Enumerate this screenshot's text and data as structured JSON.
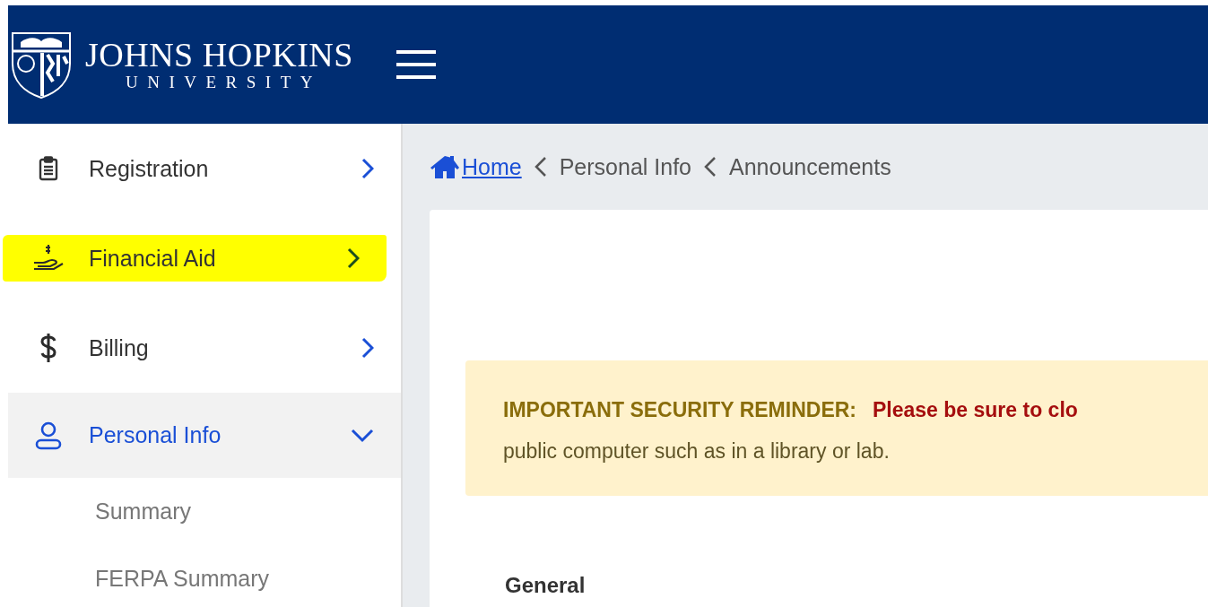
{
  "header": {
    "logo_name": "JOHNS HOPKINS",
    "logo_subtitle": "UNIVERSITY"
  },
  "sidebar": {
    "items": [
      {
        "label": "Registration",
        "expanded": false,
        "selected": false,
        "highlighted": false
      },
      {
        "label": "Financial Aid",
        "expanded": false,
        "selected": false,
        "highlighted": true
      },
      {
        "label": "Billing",
        "expanded": false,
        "selected": false,
        "highlighted": false
      },
      {
        "label": "Personal Info",
        "expanded": true,
        "selected": true,
        "highlighted": false,
        "children": [
          {
            "label": "Summary"
          },
          {
            "label": "FERPA Summary"
          }
        ]
      }
    ]
  },
  "breadcrumb": {
    "items": [
      "Home",
      "Personal Info",
      "Announcements"
    ]
  },
  "banner": {
    "title": "IMPORTANT SECURITY REMINDER:",
    "message": "Please be sure to clo",
    "continuation": "public computer such as in a library or lab."
  },
  "section": {
    "title": "General"
  }
}
